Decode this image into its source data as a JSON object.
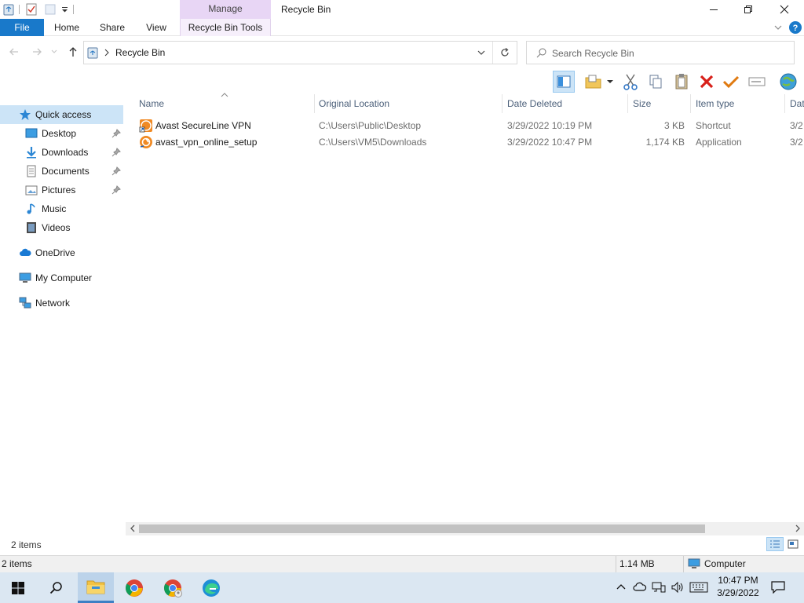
{
  "window": {
    "title": "Recycle Bin",
    "context_tab_group": "Manage"
  },
  "ribbon": {
    "tabs": {
      "file": "File",
      "home": "Home",
      "share": "Share",
      "view": "View",
      "tools": "Recycle Bin Tools"
    }
  },
  "address": {
    "breadcrumb": "Recycle Bin",
    "search_placeholder": "Search Recycle Bin"
  },
  "nav": {
    "quick_access": "Quick access",
    "items": [
      {
        "label": "Desktop",
        "icon": "desktop-icon",
        "pinned": true
      },
      {
        "label": "Downloads",
        "icon": "downloads-icon",
        "pinned": true
      },
      {
        "label": "Documents",
        "icon": "documents-icon",
        "pinned": true
      },
      {
        "label": "Pictures",
        "icon": "pictures-icon",
        "pinned": true
      },
      {
        "label": "Music",
        "icon": "music-icon",
        "pinned": false
      },
      {
        "label": "Videos",
        "icon": "videos-icon",
        "pinned": false
      }
    ],
    "onedrive": "OneDrive",
    "my_computer": "My Computer",
    "network": "Network"
  },
  "columns": {
    "name": "Name",
    "original_location": "Original Location",
    "date_deleted": "Date Deleted",
    "size": "Size",
    "item_type": "Item type",
    "date_modified": "Dat"
  },
  "files": [
    {
      "name": "Avast SecureLine VPN",
      "original_location": "C:\\Users\\Public\\Desktop",
      "date_deleted": "3/29/2022 10:19 PM",
      "size": "3 KB",
      "item_type": "Shortcut",
      "date_modified": "3/2",
      "icon": "avast-shortcut-icon"
    },
    {
      "name": "avast_vpn_online_setup",
      "original_location": "C:\\Users\\VM5\\Downloads",
      "date_deleted": "3/29/2022 10:47 PM",
      "size": "1,174 KB",
      "item_type": "Application",
      "date_modified": "3/2",
      "icon": "avast-setup-icon"
    }
  ],
  "status": {
    "item_count": "2 items"
  },
  "detail_bar": {
    "item_count": "2 items",
    "size": "1.14 MB",
    "location": "Computer"
  },
  "taskbar": {
    "time": "10:47 PM",
    "date": "3/29/2022"
  },
  "colors": {
    "file_tab": "#1979ca",
    "manage_tab": "#e8d6f5",
    "selection": "#cce4f7",
    "taskbar": "#dbe7f2"
  }
}
